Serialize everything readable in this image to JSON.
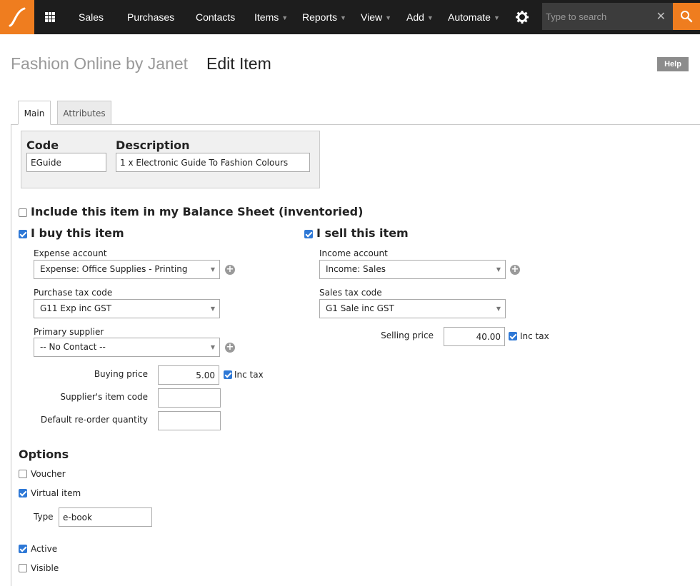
{
  "nav": {
    "items": [
      {
        "label": "Sales",
        "dropdown": false
      },
      {
        "label": "Purchases",
        "dropdown": false
      },
      {
        "label": "Contacts",
        "dropdown": false
      },
      {
        "label": "Items",
        "dropdown": true
      },
      {
        "label": "Reports",
        "dropdown": true
      },
      {
        "label": "View",
        "dropdown": true
      },
      {
        "label": "Add",
        "dropdown": true
      },
      {
        "label": "Automate",
        "dropdown": true
      }
    ],
    "search_placeholder": "Type to search",
    "logo_icon": "saasu-logo-icon",
    "accent_color": "#ef7d1f"
  },
  "header": {
    "company": "Fashion Online by Janet",
    "title": "Edit Item",
    "help_label": "Help"
  },
  "tabs": [
    {
      "label": "Main",
      "active": true
    },
    {
      "label": "Attributes",
      "active": false
    }
  ],
  "item": {
    "code_label": "Code",
    "code_value": "EGuide",
    "description_label": "Description",
    "description_value": "1 x Electronic Guide To Fashion Colours"
  },
  "inventory": {
    "label": "Include this item in my Balance Sheet (inventoried)",
    "checked": false
  },
  "buy": {
    "label": "I buy this item",
    "checked": true,
    "expense_account_label": "Expense account",
    "expense_account_value": "Expense: Office Supplies - Printing",
    "tax_code_label": "Purchase tax code",
    "tax_code_value": "G11 Exp inc GST",
    "supplier_label": "Primary supplier",
    "supplier_value": "-- No Contact --",
    "buying_price_label": "Buying price",
    "buying_price_value": "5.00",
    "inc_tax_label": "Inc tax",
    "inc_tax_checked": true,
    "supplier_code_label": "Supplier's item code",
    "supplier_code_value": "",
    "reorder_label": "Default re-order quantity",
    "reorder_value": ""
  },
  "sell": {
    "label": "I sell this item",
    "checked": true,
    "income_account_label": "Income account",
    "income_account_value": "Income: Sales",
    "tax_code_label": "Sales tax code",
    "tax_code_value": "G1 Sale inc GST",
    "selling_price_label": "Selling price",
    "selling_price_value": "40.00",
    "inc_tax_label": "Inc tax",
    "inc_tax_checked": true
  },
  "options": {
    "title": "Options",
    "voucher_label": "Voucher",
    "voucher_checked": false,
    "virtual_label": "Virtual item",
    "virtual_checked": true,
    "type_label": "Type",
    "type_value": "e-book",
    "active_label": "Active",
    "active_checked": true,
    "visible_label": "Visible",
    "visible_checked": false
  }
}
